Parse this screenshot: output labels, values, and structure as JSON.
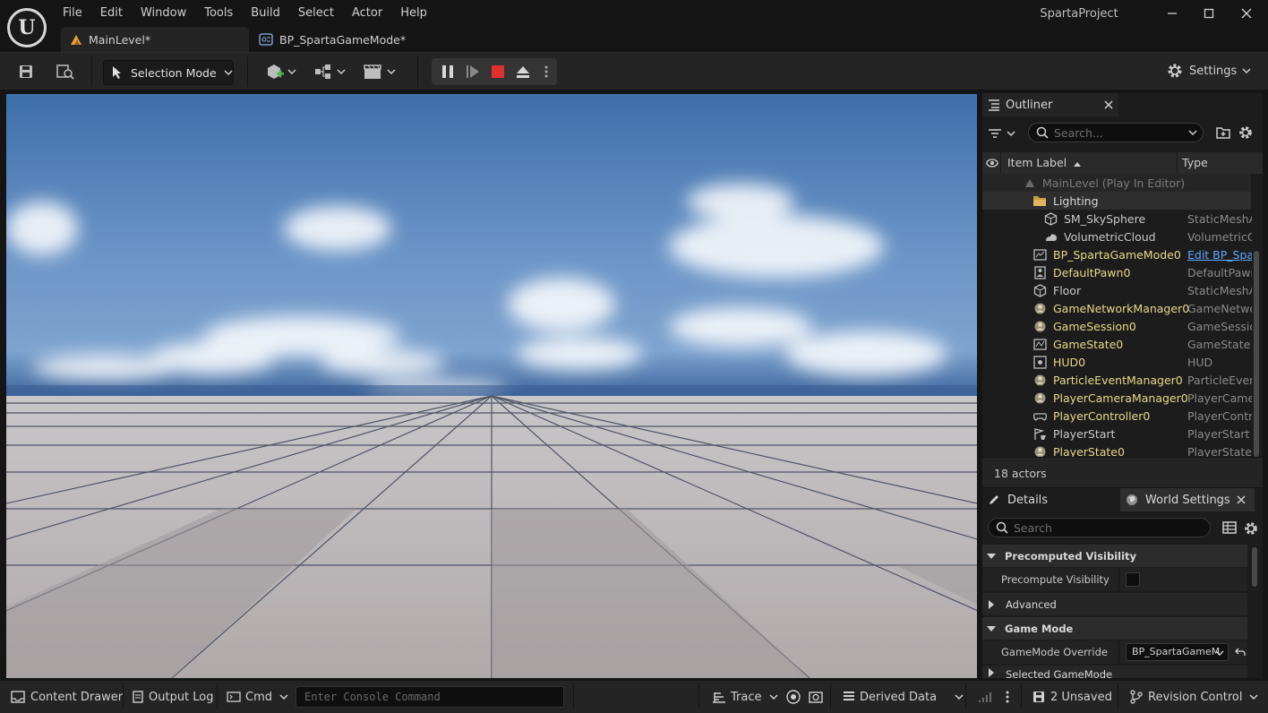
{
  "app": {
    "title": "SpartaProject",
    "logo_text": "U",
    "menu": [
      "File",
      "Edit",
      "Window",
      "Tools",
      "Build",
      "Select",
      "Actor",
      "Help"
    ]
  },
  "tabs": [
    {
      "label": "MainLevel*",
      "active": true
    },
    {
      "label": "BP_SpartaGameMode*",
      "active": false
    }
  ],
  "toolbar": {
    "selection_mode": "Selection Mode",
    "settings": "Settings"
  },
  "outliner": {
    "tab_label": "Outliner",
    "search_placeholder": "Search...",
    "col_label": "Item Label",
    "col_type": "Type",
    "level": "MainLevel (Play In Editor)",
    "folder": "Lighting",
    "rows": [
      {
        "label": "SM_SkySphere",
        "type": "StaticMeshA",
        "color": "#c8c8c8",
        "icon": "mesh-icon"
      },
      {
        "label": "VolumetricCloud",
        "type": "VolumetricC",
        "color": "#c8c8c8",
        "icon": "cloud-icon"
      },
      {
        "label": "BP_SpartaGameMode0",
        "type": "Edit BP_Spa",
        "color": "#e8d88a",
        "icon": "gamemode-icon",
        "type_link": true
      },
      {
        "label": "DefaultPawn0",
        "type": "DefaultPawn",
        "color": "#e8d88a",
        "icon": "pawn-icon"
      },
      {
        "label": "Floor",
        "type": "StaticMeshA",
        "color": "#c8c8c8",
        "icon": "mesh-icon"
      },
      {
        "label": "GameNetworkManager0",
        "type": "GameNetwo",
        "color": "#e8d88a",
        "icon": "actor-icon"
      },
      {
        "label": "GameSession0",
        "type": "GameSessio",
        "color": "#e8d88a",
        "icon": "actor-icon"
      },
      {
        "label": "GameState0",
        "type": "GameState",
        "color": "#e8d88a",
        "icon": "gamestate-icon"
      },
      {
        "label": "HUD0",
        "type": "HUD",
        "color": "#e8d88a",
        "icon": "hud-icon"
      },
      {
        "label": "ParticleEventManager0",
        "type": "ParticleEven",
        "color": "#e8d88a",
        "icon": "actor-icon"
      },
      {
        "label": "PlayerCameraManager0",
        "type": "PlayerCame",
        "color": "#e8d88a",
        "icon": "actor-icon"
      },
      {
        "label": "PlayerController0",
        "type": "PlayerContro",
        "color": "#e8d88a",
        "icon": "controller-icon"
      },
      {
        "label": "PlayerStart",
        "type": "PlayerStart",
        "color": "#c8c8c8",
        "icon": "playerstart-icon"
      },
      {
        "label": "PlayerState0",
        "type": "PlayerState",
        "color": "#e8d88a",
        "icon": "actor-icon"
      }
    ],
    "actor_count": "18 actors"
  },
  "details": {
    "tab_label": "Details",
    "world_tab_label": "World Settings",
    "search_placeholder": "Search",
    "sections": {
      "precomputed": "Precomputed Visibility",
      "precompute_prop": "Precompute Visibility",
      "advanced": "Advanced",
      "game_mode": "Game Mode",
      "override_prop": "GameMode Override",
      "override_value": "BP_SpartaGameM",
      "selected": "Selected GameMode"
    }
  },
  "statusbar": {
    "content_drawer": "Content Drawer",
    "output_log": "Output Log",
    "cmd": "Cmd",
    "console_placeholder": "Enter Console Command",
    "trace": "Trace",
    "derived_data": "Derived Data",
    "unsaved": "2 Unsaved",
    "revision_control": "Revision Control"
  },
  "colors": {
    "accent": "#e8a23a",
    "stop": "#e03030",
    "link": "#5fa8ff"
  }
}
